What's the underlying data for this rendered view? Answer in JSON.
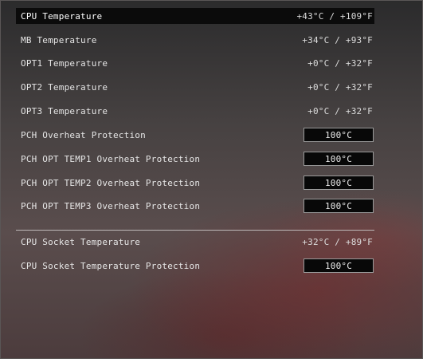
{
  "rows": [
    {
      "label": "CPU Temperature",
      "value": "+43°C / +109°F"
    },
    {
      "label": "MB Temperature",
      "value": "+34°C / +93°F"
    },
    {
      "label": "OPT1 Temperature",
      "value": "+0°C / +32°F"
    },
    {
      "label": "OPT2 Temperature",
      "value": "+0°C / +32°F"
    },
    {
      "label": "OPT3 Temperature",
      "value": "+0°C / +32°F"
    },
    {
      "label": "PCH Overheat Protection",
      "value": "100°C"
    },
    {
      "label": "PCH OPT TEMP1 Overheat Protection",
      "value": "100°C"
    },
    {
      "label": "PCH OPT TEMP2 Overheat Protection",
      "value": "100°C"
    },
    {
      "label": "PCH OPT TEMP3 Overheat Protection",
      "value": "100°C"
    },
    {
      "label": "CPU Socket Temperature",
      "value": "+32°C / +89°F"
    },
    {
      "label": "CPU Socket Temperature Protection",
      "value": "100°C"
    }
  ],
  "colors": {
    "selected_row_bg": "#0b0b0b",
    "input_box_bg": "#080808",
    "input_box_border": "#9a9a9a",
    "text": "#e6e6e6"
  }
}
